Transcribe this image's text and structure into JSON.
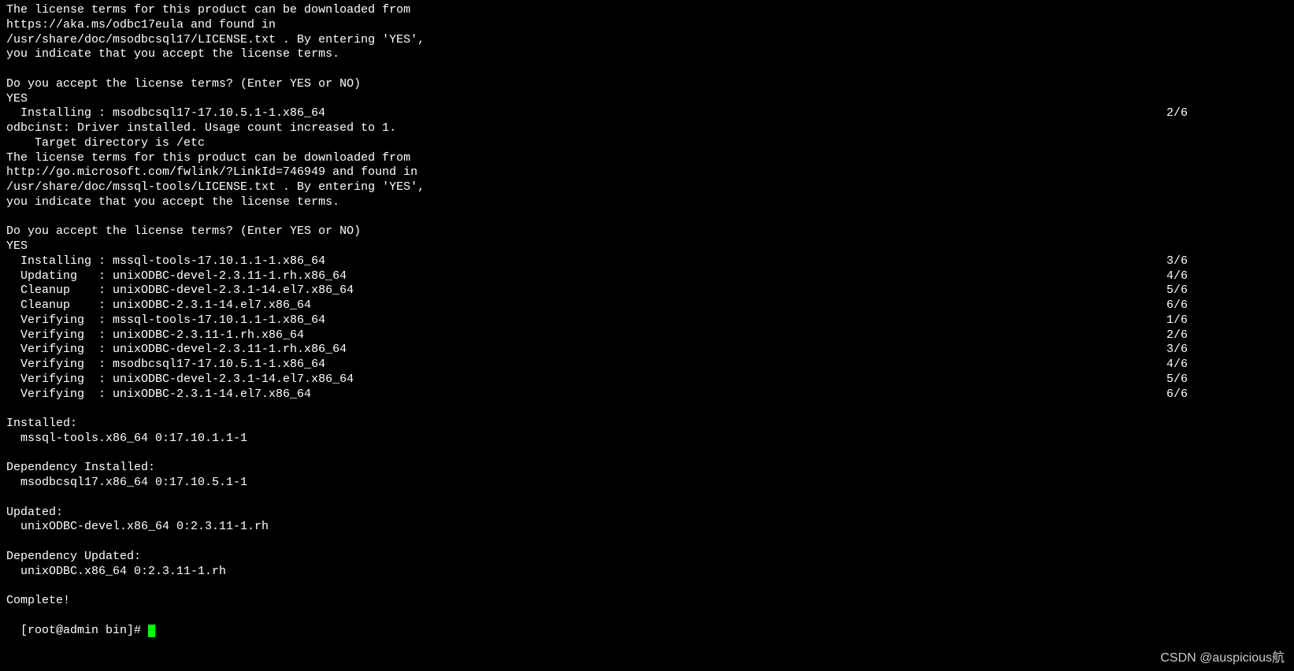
{
  "terminal": {
    "lines": [
      {
        "left": "The license terms for this product can be downloaded from",
        "right": ""
      },
      {
        "left": "https://aka.ms/odbc17eula and found in",
        "right": ""
      },
      {
        "left": "/usr/share/doc/msodbcsql17/LICENSE.txt . By entering 'YES',",
        "right": ""
      },
      {
        "left": "you indicate that you accept the license terms.",
        "right": ""
      },
      {
        "left": "",
        "right": ""
      },
      {
        "left": "Do you accept the license terms? (Enter YES or NO)",
        "right": ""
      },
      {
        "left": "YES",
        "right": ""
      },
      {
        "left": "  Installing : msodbcsql17-17.10.5.1-1.x86_64",
        "right": "2/6"
      },
      {
        "left": "odbcinst: Driver installed. Usage count increased to 1.",
        "right": ""
      },
      {
        "left": "    Target directory is /etc",
        "right": ""
      },
      {
        "left": "The license terms for this product can be downloaded from",
        "right": ""
      },
      {
        "left": "http://go.microsoft.com/fwlink/?LinkId=746949 and found in",
        "right": ""
      },
      {
        "left": "/usr/share/doc/mssql-tools/LICENSE.txt . By entering 'YES',",
        "right": ""
      },
      {
        "left": "you indicate that you accept the license terms.",
        "right": ""
      },
      {
        "left": "",
        "right": ""
      },
      {
        "left": "Do you accept the license terms? (Enter YES or NO)",
        "right": ""
      },
      {
        "left": "YES",
        "right": ""
      },
      {
        "left": "  Installing : mssql-tools-17.10.1.1-1.x86_64",
        "right": "3/6"
      },
      {
        "left": "  Updating   : unixODBC-devel-2.3.11-1.rh.x86_64",
        "right": "4/6"
      },
      {
        "left": "  Cleanup    : unixODBC-devel-2.3.1-14.el7.x86_64",
        "right": "5/6"
      },
      {
        "left": "  Cleanup    : unixODBC-2.3.1-14.el7.x86_64",
        "right": "6/6"
      },
      {
        "left": "  Verifying  : mssql-tools-17.10.1.1-1.x86_64",
        "right": "1/6"
      },
      {
        "left": "  Verifying  : unixODBC-2.3.11-1.rh.x86_64",
        "right": "2/6"
      },
      {
        "left": "  Verifying  : unixODBC-devel-2.3.11-1.rh.x86_64",
        "right": "3/6"
      },
      {
        "left": "  Verifying  : msodbcsql17-17.10.5.1-1.x86_64",
        "right": "4/6"
      },
      {
        "left": "  Verifying  : unixODBC-devel-2.3.1-14.el7.x86_64",
        "right": "5/6"
      },
      {
        "left": "  Verifying  : unixODBC-2.3.1-14.el7.x86_64",
        "right": "6/6"
      },
      {
        "left": "",
        "right": ""
      },
      {
        "left": "Installed:",
        "right": ""
      },
      {
        "left": "  mssql-tools.x86_64 0:17.10.1.1-1",
        "right": ""
      },
      {
        "left": "",
        "right": ""
      },
      {
        "left": "Dependency Installed:",
        "right": ""
      },
      {
        "left": "  msodbcsql17.x86_64 0:17.10.5.1-1",
        "right": ""
      },
      {
        "left": "",
        "right": ""
      },
      {
        "left": "Updated:",
        "right": ""
      },
      {
        "left": "  unixODBC-devel.x86_64 0:2.3.11-1.rh",
        "right": ""
      },
      {
        "left": "",
        "right": ""
      },
      {
        "left": "Dependency Updated:",
        "right": ""
      },
      {
        "left": "  unixODBC.x86_64 0:2.3.11-1.rh",
        "right": ""
      },
      {
        "left": "",
        "right": ""
      },
      {
        "left": "Complete!",
        "right": ""
      }
    ],
    "prompt": "[root@admin bin]# "
  },
  "watermark": "CSDN @auspicious航"
}
